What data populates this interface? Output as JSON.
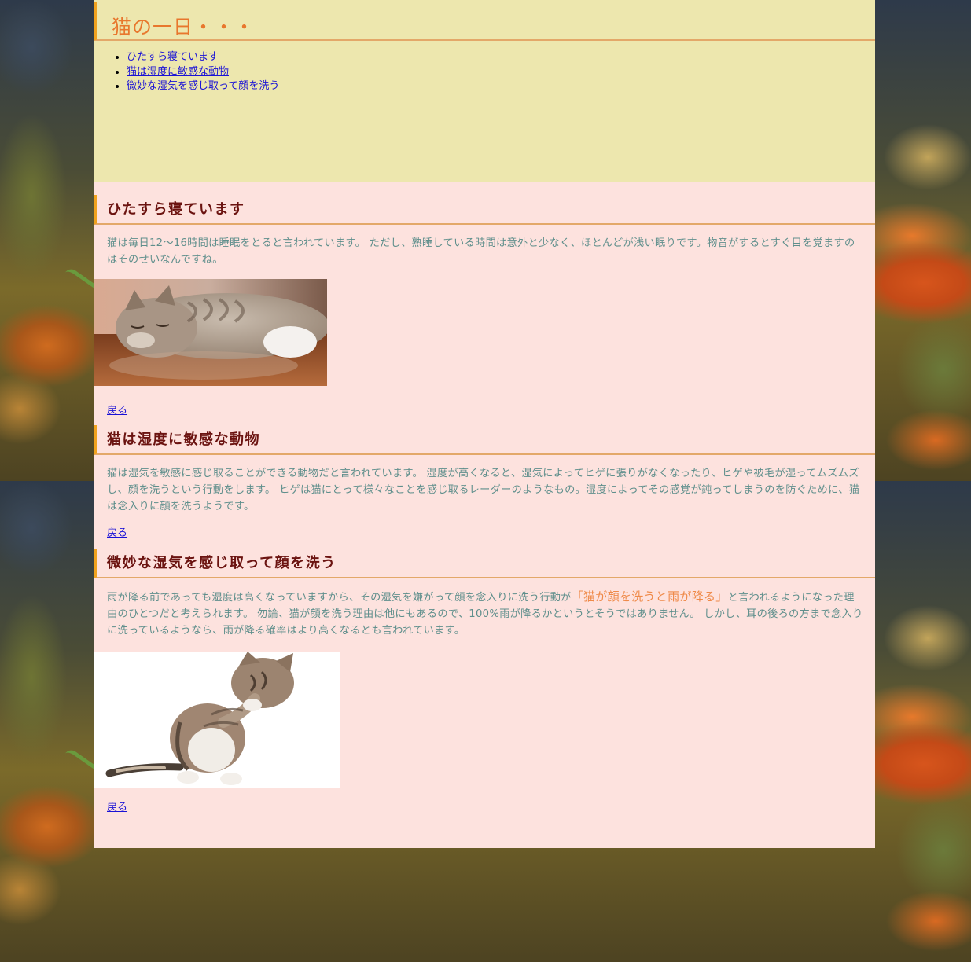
{
  "page": {
    "title": "猫の一日・・・",
    "toc": [
      {
        "label": "ひたすら寝ています"
      },
      {
        "label": "猫は湿度に敏感な動物"
      },
      {
        "label": "微妙な湿気を感じ取って顔を洗う"
      }
    ]
  },
  "sections": [
    {
      "heading": "ひたすら寝ています",
      "paragraph": "猫は毎日12～16時間は睡眠をとると言われています。 ただし、熟睡している時間は意外と少なく、ほとんどが浅い眠りです。物音がするとすぐ目を覚ますのはそのせいなんですね。",
      "back": "戻る"
    },
    {
      "heading": "猫は湿度に敏感な動物",
      "paragraph": "猫は湿気を敏感に感じ取ることができる動物だと言われています。 湿度が高くなると、湿気によってヒゲに張りがなくなったり、ヒゲや被毛が湿ってムズムズし、顔を洗うという行動をします。 ヒゲは猫にとって様々なことを感じ取るレーダーのようなもの。湿度によってその感覚が鈍ってしまうのを防ぐために、猫は念入りに顔を洗うようです。",
      "back": "戻る"
    },
    {
      "heading": "微妙な湿気を感じ取って顔を洗う",
      "paragraph_before": "雨が降る前であっても湿度は高くなっていますから、その湿気を嫌がって顔を念入りに洗う行動が",
      "highlight": "「猫が顔を洗うと雨が降る」",
      "paragraph_after": "と言われるようになった理由のひとつだと考えられます。 勿論、猫が顔を洗う理由は他にもあるので、100%雨が降るかというとそうではありません。 しかし、耳の後ろの方まで念入りに洗っているようなら、雨が降る確率はより高くなるとも言われています。",
      "back": "戻る"
    }
  ],
  "colors": {
    "header_bg": "#ede7ae",
    "content_bg": "#fde2de",
    "title": "#e8772d",
    "heading": "#6b1310",
    "accent_bar": "#f0a21e",
    "body_text": "#5f8f8c",
    "link": "#1a12d6"
  },
  "icons": {
    "background": "blurred-orange-flower-photo",
    "photo1": "sleeping-tabby-cat-photo",
    "photo2": "cat-washing-face-photo"
  }
}
